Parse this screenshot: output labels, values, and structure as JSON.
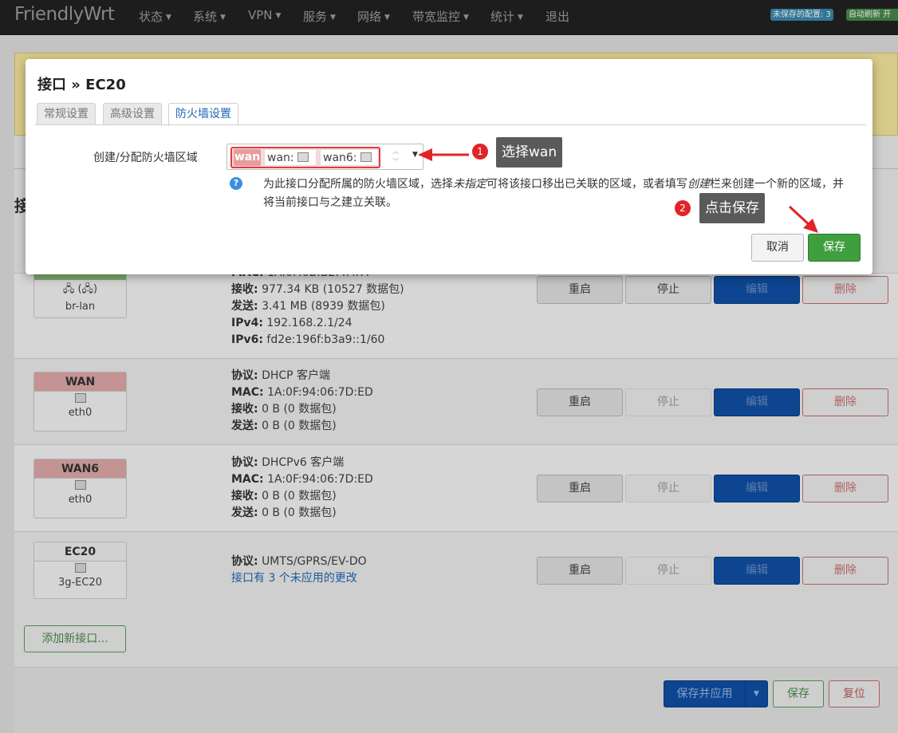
{
  "header": {
    "brand": "FriendlyWrt",
    "nav": [
      "状态",
      "系统",
      "VPN",
      "服务",
      "网络",
      "带宽监控",
      "统计",
      "退出"
    ],
    "unsaved_badge": "未保存的配置: 3",
    "autorefresh_badge": "自动刷新 开"
  },
  "interfaces": [
    {
      "name": "",
      "device": "br-lan",
      "info_lines": [
        {
          "label": "MAC:",
          "value": "1A:0F:6B:B2:4F:FA"
        },
        {
          "label": "接收:",
          "value": "977.34 KB (10527 数据包)"
        },
        {
          "label": "发送:",
          "value": "3.41 MB (8939 数据包)"
        },
        {
          "label": "IPv4:",
          "value": "192.168.2.1/24"
        },
        {
          "label": "IPv6:",
          "value": "fd2e:196f:b3a9::1/60"
        }
      ],
      "stop_disabled": false
    },
    {
      "name": "WAN",
      "device": "eth0",
      "info_lines": [
        {
          "label": "协议:",
          "value": "DHCP 客户端"
        },
        {
          "label": "MAC:",
          "value": "1A:0F:94:06:7D:ED"
        },
        {
          "label": "接收:",
          "value": "0 B (0 数据包)"
        },
        {
          "label": "发送:",
          "value": "0 B (0 数据包)"
        }
      ],
      "stop_disabled": true
    },
    {
      "name": "WAN6",
      "device": "eth0",
      "info_lines": [
        {
          "label": "协议:",
          "value": "DHCPv6 客户端"
        },
        {
          "label": "MAC:",
          "value": "1A:0F:94:06:7D:ED"
        },
        {
          "label": "接收:",
          "value": "0 B (0 数据包)"
        },
        {
          "label": "发送:",
          "value": "0 B (0 数据包)"
        }
      ],
      "stop_disabled": true
    },
    {
      "name": "EC20",
      "device": "3g-EC20",
      "info_lines": [
        {
          "label": "协议:",
          "value": "UMTS/GPRS/EV-DO"
        }
      ],
      "pending_note": "接口有 3 个未应用的更改",
      "stop_disabled": true
    }
  ],
  "row_buttons": {
    "restart": "重启",
    "stop": "停止",
    "edit": "编辑",
    "delete": "删除"
  },
  "add_interface_label": "添加新接口...",
  "footer": {
    "save_apply": "保存并应用",
    "save": "保存",
    "reset": "复位"
  },
  "modal": {
    "title": "接口 » EC20",
    "tabs": [
      "常规设置",
      "高级设置",
      "防火墙设置"
    ],
    "active_tab": "防火墙设置",
    "field_label": "创建/分配防火墙区域",
    "selected_zone": "wan",
    "zone_options": [
      "wan:",
      "wan6:"
    ],
    "help_text_parts": [
      "为此接口分配所属的防火墙区域，选择",
      "未指定",
      "可将该接口移出已关联的区域，或者填写",
      "创建",
      "栏来创建一个新的区域，并将当前接口与之建立关联。"
    ],
    "cancel": "取消",
    "save": "保存"
  },
  "annotations": [
    {
      "number": "1",
      "text": "选择wan"
    },
    {
      "number": "2",
      "text": "点击保存"
    }
  ],
  "colors": {
    "accent_red": "#e0242a",
    "save_green": "#3f9f3f",
    "edit_blue": "#0f4fa5",
    "link_blue": "#1f67b1"
  }
}
